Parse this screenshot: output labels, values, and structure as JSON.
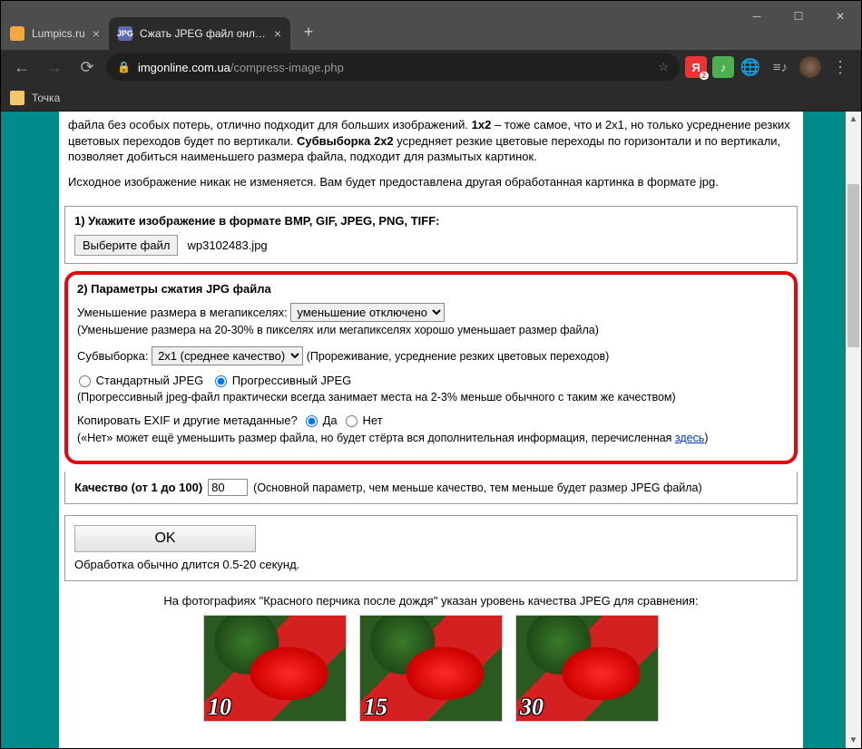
{
  "tabs": [
    {
      "title": "Lumpics.ru"
    },
    {
      "title": "Сжать JPEG файл онлайн - IMG"
    }
  ],
  "url": {
    "domain": "imgonline.com.ua",
    "path": "/compress-image.php"
  },
  "bookmark": "Точка",
  "intro": {
    "line1a": "файла без особых потерь, отлично подходит для больших изображений. ",
    "b1": "1x2",
    "line1b": " – тоже самое, что и 2x1, но только усреднение резких цветовых переходов будет по вертикали. ",
    "b2": "Субвыборка 2x2",
    "line1c": " усредняет резкие цветовые переходы по горизонтали и по вертикали, позволяет добиться наименьшего размера файла, подходит для размытых картинок.",
    "line2": "Исходное изображение никак не изменяется. Вам будет предоставлена другая обработанная картинка в формате jpg."
  },
  "step1": {
    "title": "1) Укажите изображение в формате BMP, GIF, JPEG, PNG, TIFF:",
    "button": "Выберите файл",
    "filename": "wp3102483.jpg"
  },
  "step2": {
    "title": "2) Параметры сжатия JPG файла",
    "mp_label": "Уменьшение размера в мегапикселях:",
    "mp_option": "уменьшение отключено",
    "mp_note": "(Уменьшение размера на 20-30% в пикселях или мегапикселях хорошо уменьшает размер файла)",
    "sub_label": "Субвыборка:",
    "sub_option": "2x1 (среднее качество)",
    "sub_note": "(Прореживание, усреднение резких цветовых переходов)",
    "jpeg_std": "Стандартный JPEG",
    "jpeg_prog": "Прогрессивный JPEG",
    "jpeg_note": "(Прогрессивный jpeg-файл практически всегда занимает места на 2-3% меньше обычного с таким же качеством)",
    "exif_label": "Копировать EXIF и другие метаданные?",
    "exif_yes": "Да",
    "exif_no": "Нет",
    "exif_note_a": "(«Нет» может ещё уменьшить размер файла, но будет стёрта вся дополнительная информация, перечисленная ",
    "exif_link": "здесь",
    "exif_note_b": ")"
  },
  "quality": {
    "label": "Качество (от 1 до 100)",
    "value": "80",
    "note": "(Основной параметр, чем меньше качество, тем меньше будет размер JPEG файла)"
  },
  "submit": {
    "button": "OK",
    "hint": "Обработка обычно длится 0.5-20 секунд."
  },
  "compare": {
    "caption": "На фотографиях \"Красного перчика после дождя\" указан уровень качества JPEG для сравнения:",
    "levels": [
      "10",
      "15",
      "30"
    ]
  }
}
